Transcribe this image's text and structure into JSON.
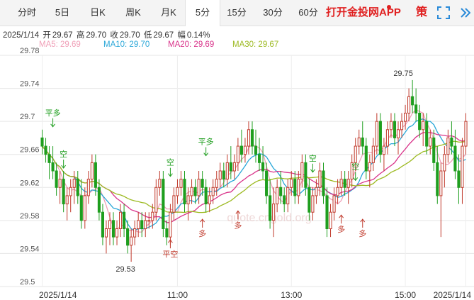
{
  "tabs": [
    {
      "label": "分时",
      "active": false
    },
    {
      "label": "5日",
      "active": false
    },
    {
      "label": "日K",
      "active": false
    },
    {
      "label": "周K",
      "active": false
    },
    {
      "label": "月K",
      "active": false
    },
    {
      "label": "5分",
      "active": true
    },
    {
      "label": "15分",
      "active": false
    },
    {
      "label": "30分",
      "active": false
    },
    {
      "label": "60分",
      "active": false
    }
  ],
  "brand": "打开金投网APP",
  "policy_label": "策",
  "info": {
    "date": "2025/1/14",
    "open_label": "开",
    "open": "29.67",
    "high_label": "高",
    "high": "29.70",
    "close_label": "收",
    "close": "29.70",
    "low_label": "低",
    "low": "29.67",
    "change_label": "幅",
    "change": "0.14%"
  },
  "ma": [
    {
      "label": "MA5: 29.69",
      "color": "#f0a0b8"
    },
    {
      "label": "MA10: 29.70",
      "color": "#2aa7d8"
    },
    {
      "label": "MA20: 29.69",
      "color": "#d9338a"
    },
    {
      "label": "MA30: 29.67",
      "color": "#9dba22"
    }
  ],
  "watermark": "quote.cngold.org",
  "colors": {
    "up": "#c0392b",
    "down": "#1e9e1e",
    "grid": "#e6e6e6",
    "axis_text": "#555555",
    "signal": "#c0392b",
    "signal_green": "#1e9e1e"
  },
  "chart_data": {
    "type": "candlestick",
    "ylim": [
      29.5,
      29.78
    ],
    "yticks": [
      "29.5",
      "29.54",
      "29.58",
      "29.62",
      "29.66",
      "29.7",
      "29.74",
      "29.78"
    ],
    "xticks": [
      {
        "index": 0,
        "label": "2025/1/14"
      },
      {
        "index": 38,
        "label": "11:00"
      },
      {
        "index": 70,
        "label": "13:00"
      },
      {
        "index": 102,
        "label": "15:00"
      },
      {
        "index": 119,
        "label": "2025/1/14"
      }
    ],
    "candles": [
      [
        29.68,
        29.69,
        29.66,
        29.67
      ],
      [
        29.67,
        29.68,
        29.65,
        29.66
      ],
      [
        29.66,
        29.67,
        29.63,
        29.65
      ],
      [
        29.65,
        29.67,
        29.63,
        29.64
      ],
      [
        29.64,
        29.65,
        29.61,
        29.62
      ],
      [
        29.62,
        29.64,
        29.6,
        29.63
      ],
      [
        29.63,
        29.64,
        29.59,
        29.6
      ],
      [
        29.6,
        29.62,
        29.58,
        29.61
      ],
      [
        29.61,
        29.63,
        29.59,
        29.62
      ],
      [
        29.62,
        29.64,
        29.6,
        29.63
      ],
      [
        29.63,
        29.64,
        29.6,
        29.61
      ],
      [
        29.61,
        29.63,
        29.57,
        29.58
      ],
      [
        29.58,
        29.62,
        29.57,
        29.61
      ],
      [
        29.61,
        29.64,
        29.6,
        29.63
      ],
      [
        29.63,
        29.66,
        29.62,
        29.65
      ],
      [
        29.65,
        29.66,
        29.61,
        29.62
      ],
      [
        29.62,
        29.63,
        29.58,
        29.59
      ],
      [
        29.59,
        29.6,
        29.55,
        29.56
      ],
      [
        29.56,
        29.58,
        29.54,
        29.57
      ],
      [
        29.57,
        29.59,
        29.55,
        29.58
      ],
      [
        29.58,
        29.59,
        29.55,
        29.56
      ],
      [
        29.56,
        29.58,
        29.55,
        29.57
      ],
      [
        29.57,
        29.6,
        29.56,
        29.59
      ],
      [
        29.59,
        29.6,
        29.56,
        29.57
      ],
      [
        29.57,
        29.58,
        29.54,
        29.55
      ],
      [
        29.55,
        29.57,
        29.53,
        29.56
      ],
      [
        29.56,
        29.58,
        29.55,
        29.57
      ],
      [
        29.57,
        29.59,
        29.56,
        29.58
      ],
      [
        29.58,
        29.59,
        29.56,
        29.57
      ],
      [
        29.57,
        29.59,
        29.56,
        29.58
      ],
      [
        29.58,
        29.59,
        29.57,
        29.58
      ],
      [
        29.58,
        29.6,
        29.57,
        29.59
      ],
      [
        29.59,
        29.63,
        29.58,
        29.62
      ],
      [
        29.62,
        29.64,
        29.61,
        29.63
      ],
      [
        29.63,
        29.64,
        29.56,
        29.57
      ],
      [
        29.57,
        29.58,
        29.55,
        29.56
      ],
      [
        29.56,
        29.6,
        29.55,
        29.59
      ],
      [
        29.59,
        29.62,
        29.58,
        29.61
      ],
      [
        29.61,
        29.63,
        29.6,
        29.62
      ],
      [
        29.62,
        29.64,
        29.61,
        29.63
      ],
      [
        29.63,
        29.64,
        29.59,
        29.6
      ],
      [
        29.6,
        29.62,
        29.58,
        29.61
      ],
      [
        29.61,
        29.63,
        29.6,
        29.62
      ],
      [
        29.62,
        29.63,
        29.6,
        29.61
      ],
      [
        29.61,
        29.64,
        29.6,
        29.63
      ],
      [
        29.63,
        29.64,
        29.61,
        29.62
      ],
      [
        29.62,
        29.63,
        29.59,
        29.6
      ],
      [
        29.6,
        29.62,
        29.59,
        29.61
      ],
      [
        29.61,
        29.63,
        29.6,
        29.62
      ],
      [
        29.62,
        29.64,
        29.61,
        29.63
      ],
      [
        29.63,
        29.65,
        29.62,
        29.64
      ],
      [
        29.64,
        29.65,
        29.62,
        29.63
      ],
      [
        29.63,
        29.66,
        29.62,
        29.65
      ],
      [
        29.65,
        29.67,
        29.63,
        29.64
      ],
      [
        29.64,
        29.66,
        29.63,
        29.65
      ],
      [
        29.65,
        29.68,
        29.64,
        29.67
      ],
      [
        29.67,
        29.69,
        29.65,
        29.66
      ],
      [
        29.66,
        29.68,
        29.65,
        29.67
      ],
      [
        29.67,
        29.7,
        29.66,
        29.69
      ],
      [
        29.69,
        29.7,
        29.66,
        29.67
      ],
      [
        29.67,
        29.69,
        29.65,
        29.66
      ],
      [
        29.66,
        29.68,
        29.64,
        29.65
      ],
      [
        29.65,
        29.67,
        29.63,
        29.64
      ],
      [
        29.64,
        29.65,
        29.6,
        29.61
      ],
      [
        29.61,
        29.63,
        29.57,
        29.58
      ],
      [
        29.58,
        29.62,
        29.56,
        29.6
      ],
      [
        29.6,
        29.63,
        29.59,
        29.62
      ],
      [
        29.62,
        29.64,
        29.6,
        29.61
      ],
      [
        29.61,
        29.62,
        29.59,
        29.6
      ],
      [
        29.6,
        29.63,
        29.59,
        29.62
      ],
      [
        29.62,
        29.64,
        29.61,
        29.63
      ],
      [
        29.63,
        29.64,
        29.6,
        29.61
      ],
      [
        29.61,
        29.64,
        29.6,
        29.63
      ],
      [
        29.63,
        29.66,
        29.62,
        29.65
      ],
      [
        29.65,
        29.66,
        29.61,
        29.62
      ],
      [
        29.62,
        29.63,
        29.58,
        29.59
      ],
      [
        29.59,
        29.62,
        29.58,
        29.61
      ],
      [
        29.61,
        29.63,
        29.6,
        29.62
      ],
      [
        29.62,
        29.65,
        29.61,
        29.64
      ],
      [
        29.64,
        29.65,
        29.6,
        29.61
      ],
      [
        29.61,
        29.62,
        29.56,
        29.57
      ],
      [
        29.57,
        29.6,
        29.56,
        29.59
      ],
      [
        29.59,
        29.62,
        29.58,
        29.61
      ],
      [
        29.61,
        29.63,
        29.6,
        29.62
      ],
      [
        29.62,
        29.64,
        29.61,
        29.63
      ],
      [
        29.63,
        29.64,
        29.61,
        29.62
      ],
      [
        29.62,
        29.64,
        29.6,
        29.63
      ],
      [
        29.63,
        29.66,
        29.62,
        29.65
      ],
      [
        29.65,
        29.68,
        29.64,
        29.67
      ],
      [
        29.67,
        29.69,
        29.66,
        29.68
      ],
      [
        29.68,
        29.7,
        29.66,
        29.67
      ],
      [
        29.67,
        29.68,
        29.63,
        29.64
      ],
      [
        29.64,
        29.66,
        29.62,
        29.65
      ],
      [
        29.65,
        29.68,
        29.64,
        29.67
      ],
      [
        29.67,
        29.71,
        29.66,
        29.7
      ],
      [
        29.7,
        29.71,
        29.65,
        29.66
      ],
      [
        29.66,
        29.68,
        29.64,
        29.67
      ],
      [
        29.67,
        29.7,
        29.66,
        29.69
      ],
      [
        29.69,
        29.71,
        29.68,
        29.7
      ],
      [
        29.7,
        29.71,
        29.67,
        29.68
      ],
      [
        29.68,
        29.7,
        29.66,
        29.69
      ],
      [
        29.69,
        29.71,
        29.68,
        29.7
      ],
      [
        29.7,
        29.72,
        29.69,
        29.71
      ],
      [
        29.71,
        29.74,
        29.7,
        29.73
      ],
      [
        29.73,
        29.75,
        29.71,
        29.72
      ],
      [
        29.72,
        29.74,
        29.7,
        29.71
      ],
      [
        29.71,
        29.72,
        29.68,
        29.69
      ],
      [
        29.69,
        29.71,
        29.67,
        29.7
      ],
      [
        29.7,
        29.71,
        29.66,
        29.67
      ],
      [
        29.67,
        29.69,
        29.66,
        29.68
      ],
      [
        29.68,
        29.69,
        29.64,
        29.65
      ],
      [
        29.65,
        29.67,
        29.6,
        29.61
      ],
      [
        29.61,
        29.65,
        29.56,
        29.64
      ],
      [
        29.64,
        29.67,
        29.62,
        29.66
      ],
      [
        29.66,
        29.69,
        29.65,
        29.68
      ],
      [
        29.68,
        29.7,
        29.66,
        29.67
      ],
      [
        29.67,
        29.69,
        29.63,
        29.64
      ],
      [
        29.64,
        29.66,
        29.6,
        29.62
      ],
      [
        29.62,
        29.68,
        29.6,
        29.67
      ],
      [
        29.67,
        29.71,
        29.66,
        29.7
      ]
    ],
    "ma": [
      {
        "name": "MA5",
        "color": "#f0a0b8"
      },
      {
        "name": "MA10",
        "color": "#2aa7d8"
      },
      {
        "name": "MA20",
        "color": "#d9338a"
      },
      {
        "name": "MA30",
        "color": "#9dba22"
      }
    ],
    "annotations": [
      {
        "type": "text",
        "index": 25,
        "value": 29.53,
        "text": "29.53",
        "pos": "below"
      },
      {
        "type": "text",
        "index": 103,
        "value": 29.75,
        "text": "29.75",
        "pos": "above"
      }
    ],
    "signals": [
      {
        "index": 3,
        "text": "平多",
        "dir": "down",
        "color": "green",
        "price": 29.69
      },
      {
        "index": 6,
        "text": "空",
        "dir": "down",
        "color": "green",
        "price": 29.64
      },
      {
        "index": 36,
        "text": "空",
        "dir": "down",
        "color": "green",
        "price": 29.63
      },
      {
        "index": 36,
        "text": "平空",
        "dir": "up",
        "color": "red",
        "price": 29.56
      },
      {
        "index": 45,
        "text": "多",
        "dir": "up",
        "color": "red",
        "price": 29.585
      },
      {
        "index": 46,
        "text": "平多",
        "dir": "down",
        "color": "green",
        "price": 29.655
      },
      {
        "index": 55,
        "text": "多",
        "dir": "up",
        "color": "red",
        "price": 29.595
      },
      {
        "index": 76,
        "text": "空",
        "dir": "down",
        "color": "green",
        "price": 29.635
      },
      {
        "index": 84,
        "text": "多",
        "dir": "up",
        "color": "red",
        "price": 29.59
      },
      {
        "index": 88,
        "text": "空",
        "dir": "down",
        "color": "green",
        "price": 29.625
      },
      {
        "index": 90,
        "text": "多",
        "dir": "up",
        "color": "red",
        "price": 29.585
      }
    ]
  }
}
